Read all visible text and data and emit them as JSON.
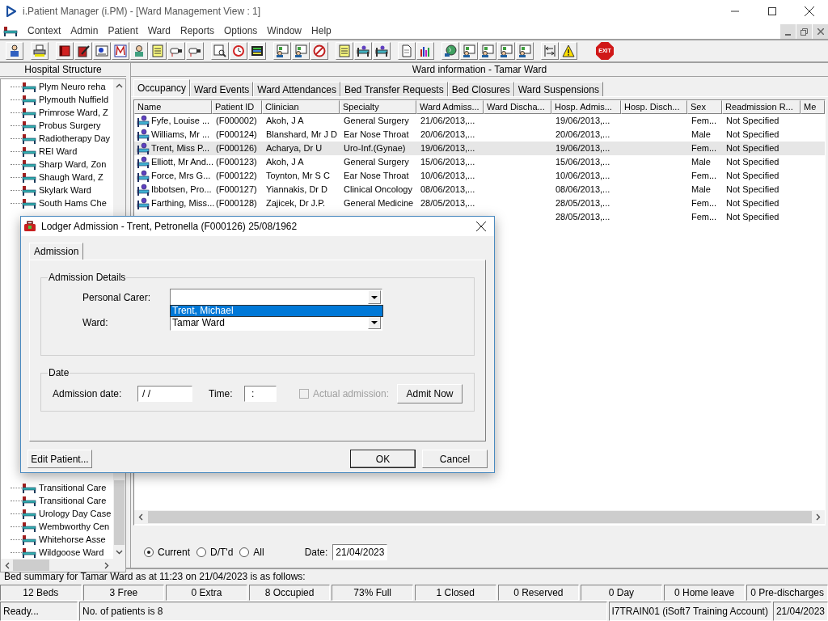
{
  "window": {
    "title": "i.Patient Manager (i.PM) - [Ward Management View : 1]"
  },
  "menu": [
    "Context",
    "Admin",
    "Patient",
    "Ward",
    "Reports",
    "Options",
    "Window",
    "Help"
  ],
  "toolbar": {
    "exit_label": "EXIT"
  },
  "hospital_structure": {
    "title": "Hospital Structure",
    "top_items": [
      "Plym Neuro reha",
      "Plymouth Nuffield",
      "Primrose Ward, Z",
      "Probus Surgery",
      "Radiotherapy Day",
      "REI Ward",
      "Sharp Ward, Zon",
      "Shaugh Ward, Z",
      "Skylark Ward",
      "South Hams Che"
    ],
    "bottom_items": [
      "Transitional Care",
      "Transitional Care",
      "Urology Day Case",
      "Wembworthy Cen",
      "Whitehorse Asse",
      "Wildgoose Ward"
    ]
  },
  "ward_info": {
    "title": "Ward information - Tamar Ward",
    "tabs": [
      {
        "label": "Occupancy",
        "selected": true
      },
      {
        "label": "Ward Events",
        "selected": false
      },
      {
        "label": "Ward Attendances",
        "selected": false
      },
      {
        "label": "Bed Transfer Requests",
        "selected": false
      },
      {
        "label": "Bed Closures",
        "selected": false
      },
      {
        "label": "Ward Suspensions",
        "selected": false
      }
    ],
    "table": {
      "columns": [
        "Name",
        "Patient ID",
        "Clinician",
        "Specialty",
        "Ward Admiss...",
        "Ward Discha...",
        "Hosp. Admis...",
        "Hosp. Disch...",
        "Sex",
        "Readmission R...",
        "Me"
      ],
      "rows": [
        {
          "selected": false,
          "cells": [
            "Fyfe, Louise ...",
            "(F000002)",
            "Akoh, J A",
            "General Surgery",
            "21/06/2013,...",
            null,
            "19/06/2013,...",
            null,
            "Fem...",
            "Not Specified"
          ]
        },
        {
          "selected": false,
          "cells": [
            "Williams, Mr ...",
            "(F000124)",
            "Blanshard, Mr J D",
            "Ear Nose Throat",
            "20/06/2013,...",
            null,
            "20/06/2013,...",
            null,
            "Male",
            "Not Specified"
          ]
        },
        {
          "selected": true,
          "cells": [
            "Trent, Miss P...",
            "(F000126)",
            "Acharya, Dr U",
            "Uro-Inf.(Gynae)",
            "19/06/2013,...",
            null,
            "19/06/2013,...",
            null,
            "Fem...",
            "Not Specified"
          ]
        },
        {
          "selected": false,
          "cells": [
            "Elliott, Mr And...",
            "(F000123)",
            "Akoh, J A",
            "General Surgery",
            "15/06/2013,...",
            null,
            "15/06/2013,...",
            null,
            "Male",
            "Not Specified"
          ]
        },
        {
          "selected": false,
          "cells": [
            "Force, Mrs G...",
            "(F000122)",
            "Toynton, Mr S C",
            "Ear Nose Throat",
            "10/06/2013,...",
            null,
            "10/06/2013,...",
            null,
            "Fem...",
            "Not Specified"
          ]
        },
        {
          "selected": false,
          "cells": [
            "Ibbotsen, Pro...",
            "(F000127)",
            "Yiannakis, Dr D",
            "Clinical Oncology",
            "08/06/2013,...",
            null,
            "08/06/2013,...",
            null,
            "Male",
            "Not Specified"
          ]
        },
        {
          "selected": false,
          "cells": [
            "Farthing, Miss...",
            "(F000128)",
            "Zajicek, Dr J.P.",
            "General Medicine",
            "28/05/2013,...",
            null,
            "28/05/2013,...",
            null,
            "Fem...",
            "Not Specified"
          ]
        },
        {
          "selected": false,
          "cells": [
            null,
            null,
            null,
            null,
            null,
            null,
            "28/05/2013,...",
            null,
            "Fem...",
            "Not Specified"
          ]
        }
      ]
    },
    "filters": [
      {
        "label": "Current",
        "selected": true
      },
      {
        "label": "D/T'd",
        "selected": false
      },
      {
        "label": "All",
        "selected": false
      }
    ],
    "date_label": "Date:",
    "date_value": "21/04/2023"
  },
  "bed_summary": {
    "caption": "Bed summary for Tamar Ward as at 11:23 on 21/04/2023 is as follows:",
    "cells": [
      "12 Beds",
      "3 Free",
      "0 Extra",
      "8 Occupied",
      "73% Full",
      "1 Closed",
      "0 Reserved",
      "0 Day",
      "0 Home leave",
      "0 Pre-discharges"
    ]
  },
  "status_bar": [
    "Ready...",
    "No. of patients is 8",
    "I7TRAIN01 (iSoft7 Training Account)",
    "21/04/2023"
  ],
  "dialog": {
    "title": "Lodger Admission - Trent, Petronella (F000126) 25/08/1962",
    "tabs": [
      {
        "label": "Admission",
        "selected": true
      }
    ],
    "details_group": "Admission Details",
    "personal_carer": {
      "label": "Personal Carer:",
      "expanded": true,
      "options": [
        {
          "label": "Trent, Michael",
          "selected": true
        }
      ]
    },
    "ward": {
      "label": "Ward:",
      "value": "Tamar Ward"
    },
    "date_group": "Date",
    "admission_date": {
      "label": "Admission date:",
      "value": "/ /"
    },
    "time": {
      "label": "Time:",
      "value": ":"
    },
    "actual_admission": {
      "label": "Actual admission:",
      "checked": false,
      "disabled": true
    },
    "buttons": {
      "admit_now": "Admit Now",
      "edit_patient": "Edit Patient...",
      "ok": "OK",
      "cancel": "Cancel"
    }
  }
}
